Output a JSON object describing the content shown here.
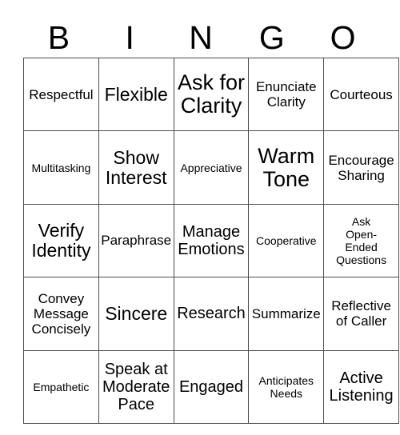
{
  "card": {
    "title": "BINGO",
    "header_letters": [
      "B",
      "I",
      "N",
      "G",
      "O"
    ],
    "grid_size": "5x5",
    "colors": {
      "background": "#ffffff",
      "text": "#000000",
      "grid_line": "#4d4d4d"
    }
  },
  "columns": [
    {
      "letter": "B"
    },
    {
      "letter": "I"
    },
    {
      "letter": "N"
    },
    {
      "letter": "G"
    },
    {
      "letter": "O"
    }
  ],
  "rows": [
    {
      "cells": [
        {
          "text": "Respectful",
          "size": "fs-m"
        },
        {
          "text": "Flexible",
          "size": "fs-xl"
        },
        {
          "text": "Ask for\nClarity",
          "size": "fs-xxl"
        },
        {
          "text": "Enunciate\nClarity",
          "size": "fs-m"
        },
        {
          "text": "Courteous",
          "size": "fs-m"
        }
      ]
    },
    {
      "cells": [
        {
          "text": "Multitasking",
          "size": "fs-s"
        },
        {
          "text": "Show\nInterest",
          "size": "fs-xl"
        },
        {
          "text": "Appreciative",
          "size": "fs-s"
        },
        {
          "text": "Warm\nTone",
          "size": "fs-xxl"
        },
        {
          "text": "Encourage\nSharing",
          "size": "fs-m"
        }
      ]
    },
    {
      "cells": [
        {
          "text": "Verify\nIdentity",
          "size": "fs-xl"
        },
        {
          "text": "Paraphrase",
          "size": "fs-m"
        },
        {
          "text": "Manage\nEmotions",
          "size": "fs-l"
        },
        {
          "text": "Cooperative",
          "size": "fs-s"
        },
        {
          "text": "Ask\nOpen-\nEnded\nQuestions",
          "size": "fs-s"
        }
      ]
    },
    {
      "cells": [
        {
          "text": "Convey\nMessage\nConcisely",
          "size": "fs-m"
        },
        {
          "text": "Sincere",
          "size": "fs-xl"
        },
        {
          "text": "Research",
          "size": "fs-l"
        },
        {
          "text": "Summarize",
          "size": "fs-m"
        },
        {
          "text": "Reflective\nof Caller",
          "size": "fs-m"
        }
      ]
    },
    {
      "cells": [
        {
          "text": "Empathetic",
          "size": "fs-s"
        },
        {
          "text": "Speak at\nModerate\nPace",
          "size": "fs-l"
        },
        {
          "text": "Engaged",
          "size": "fs-l"
        },
        {
          "text": "Anticipates\nNeeds",
          "size": "fs-s"
        },
        {
          "text": "Active\nListening",
          "size": "fs-l"
        }
      ]
    }
  ]
}
